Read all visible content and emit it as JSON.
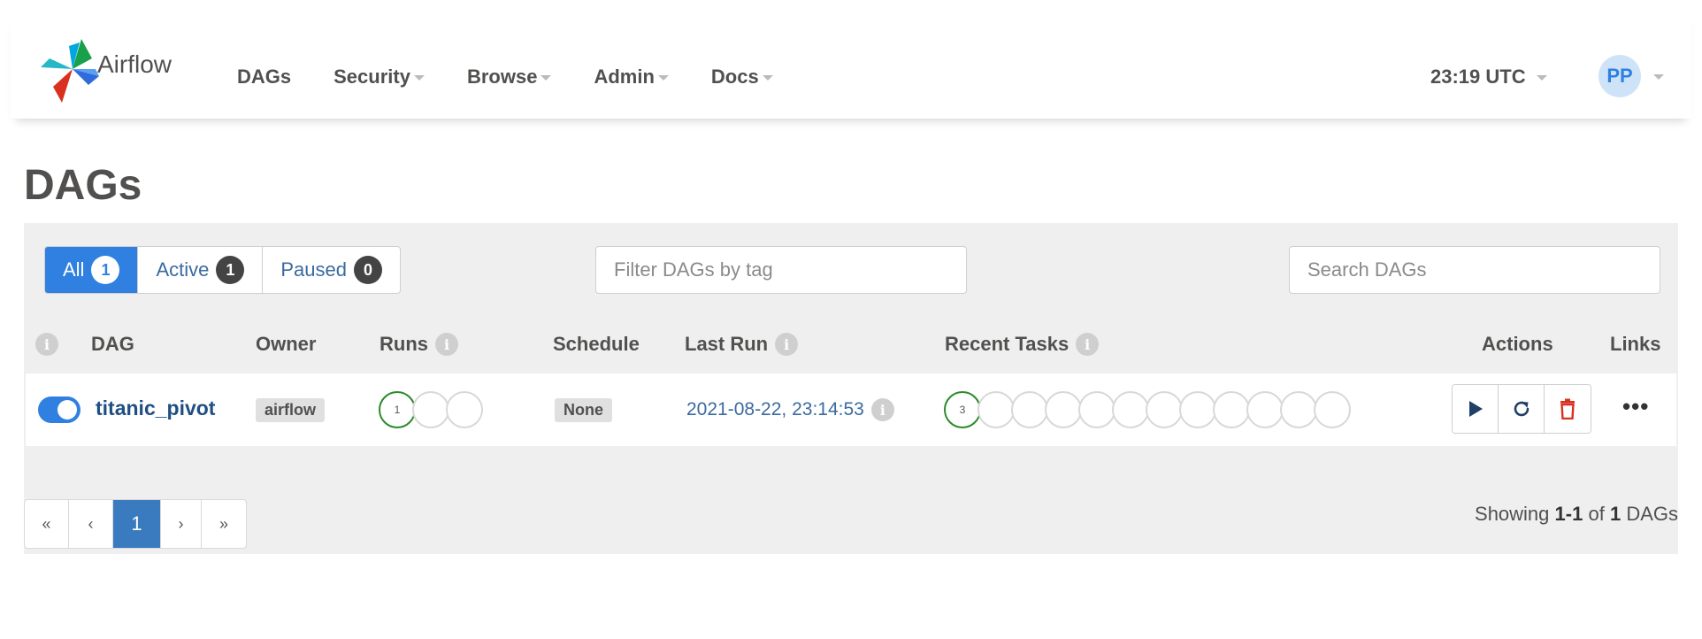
{
  "navbar": {
    "brand": "Airflow",
    "items": [
      {
        "label": "DAGs",
        "dropdown": false
      },
      {
        "label": "Security",
        "dropdown": true
      },
      {
        "label": "Browse",
        "dropdown": true
      },
      {
        "label": "Admin",
        "dropdown": true
      },
      {
        "label": "Docs",
        "dropdown": true
      }
    ],
    "clock": "23:19 UTC",
    "user_initials": "PP"
  },
  "page_title": "DAGs",
  "filters": {
    "all_label": "All",
    "all_count": "1",
    "active_label": "Active",
    "active_count": "1",
    "paused_label": "Paused",
    "paused_count": "0"
  },
  "tag_filter_placeholder": "Filter DAGs by tag",
  "search_placeholder": "Search DAGs",
  "columns": {
    "info": "i",
    "dag": "DAG",
    "owner": "Owner",
    "runs": "Runs",
    "schedule": "Schedule",
    "last_run": "Last Run",
    "recent_tasks": "Recent Tasks",
    "actions": "Actions",
    "links": "Links"
  },
  "dags": [
    {
      "name": "titanic_pivot",
      "owner": "airflow",
      "paused": false,
      "runs": {
        "success_count": "1"
      },
      "schedule": "None",
      "last_run": "2021-08-22, 23:14:53",
      "recent_tasks": {
        "success_count": "3"
      }
    }
  ],
  "pagination": {
    "first": "«",
    "prev": "‹",
    "current": "1",
    "next": "›",
    "last": "»"
  },
  "showing": {
    "prefix": "Showing",
    "range": "1-1",
    "of": "of",
    "total": "1",
    "suffix": "DAGs"
  },
  "colors": {
    "accent": "#2f80e0",
    "success": "#2a8a2a",
    "link": "#1f4f82",
    "delete": "#d9301f"
  },
  "icons": [
    "airflow-logo-icon",
    "info-icon",
    "play-icon",
    "refresh-icon",
    "trash-icon",
    "ellipsis-icon"
  ]
}
